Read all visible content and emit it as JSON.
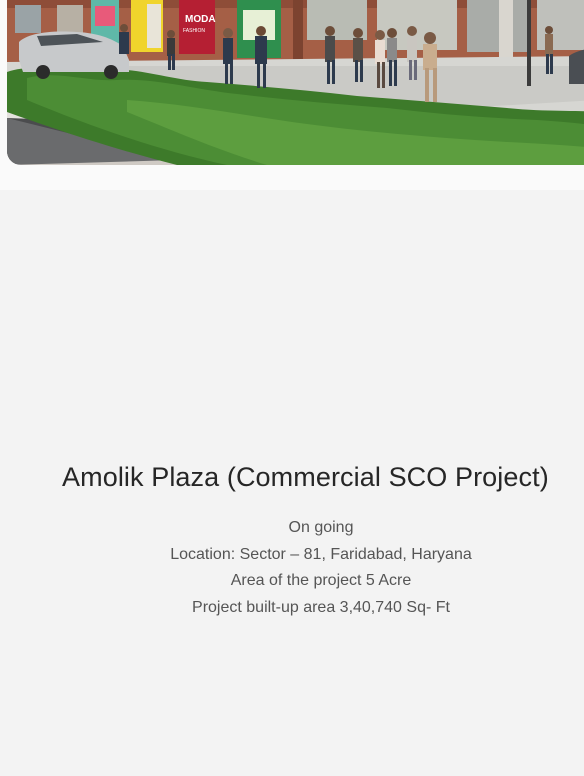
{
  "project": {
    "title": "Amolik Plaza (Commercial SCO Project)",
    "status": "On going",
    "location": "Location: Sector – 81, Faridabad, Haryana",
    "area": "Area of the project 5 Acre",
    "built_up_area": "Project built-up area 3,40,740 Sq- Ft"
  },
  "hero": {
    "shop_signs": [
      "MODA",
      "FASHION"
    ]
  },
  "colors": {
    "background": "#f3f3f3",
    "title_text": "#262626",
    "body_text": "#555555",
    "hedge": "#3d7a2a",
    "facade_brick": "#a05d44"
  }
}
